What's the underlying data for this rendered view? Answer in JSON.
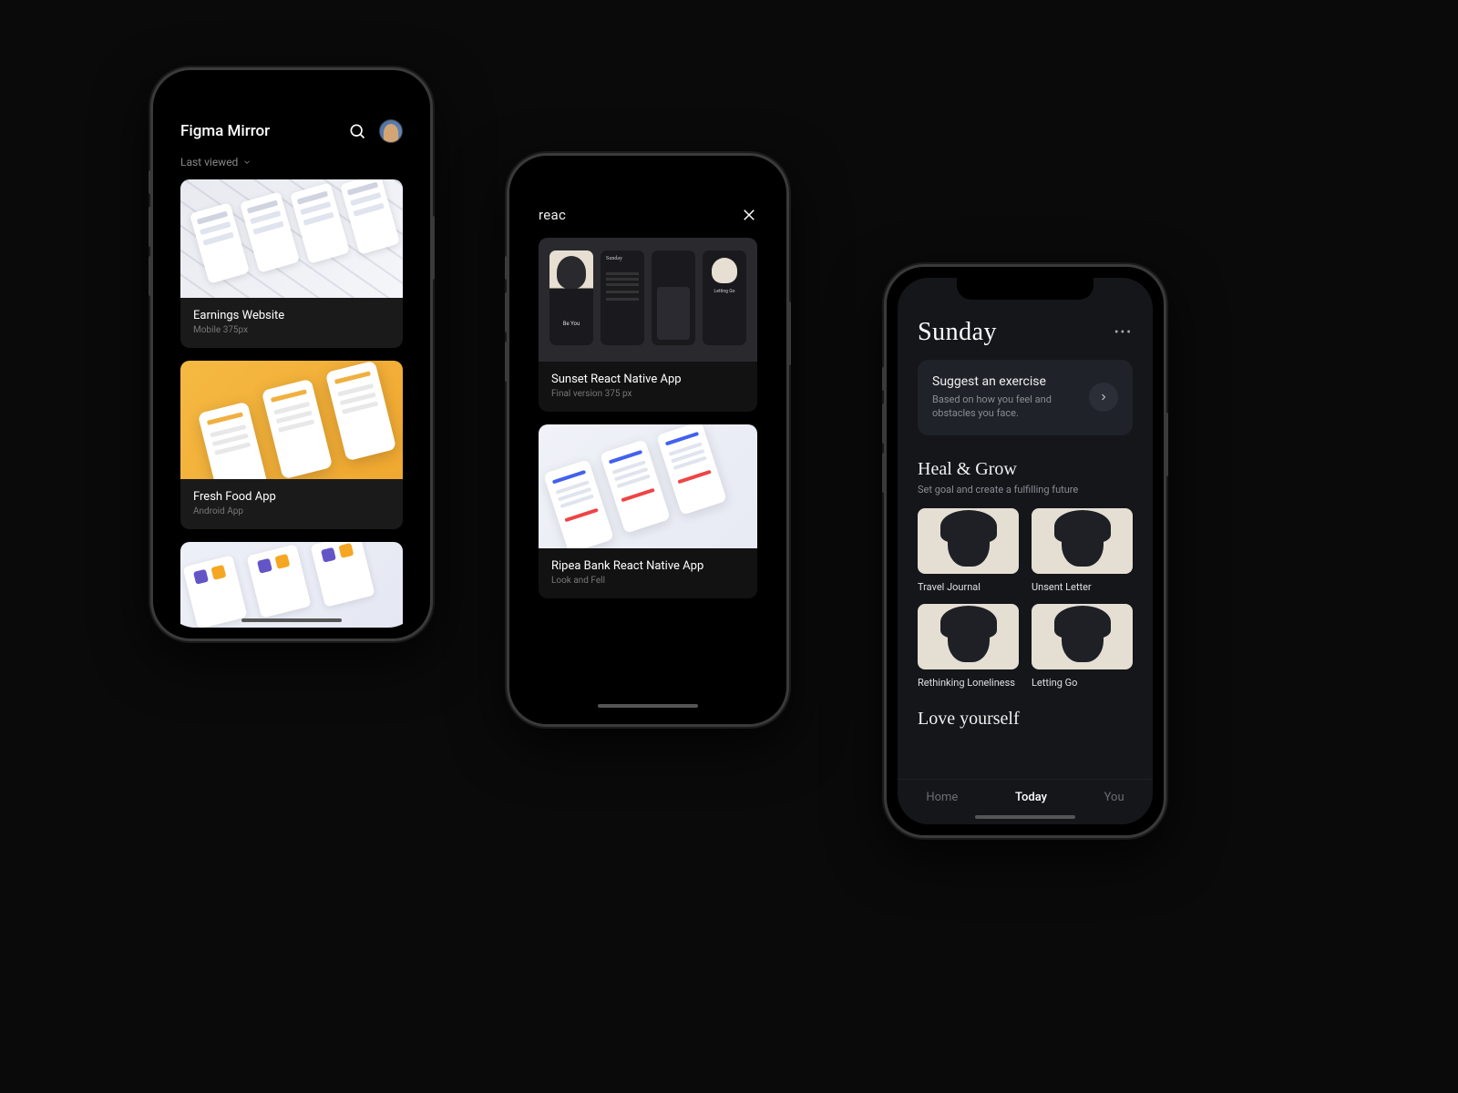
{
  "phone1": {
    "app_title": "Figma Mirror",
    "sort_label": "Last viewed",
    "cards": [
      {
        "title": "Earnings Website",
        "subtitle": "Mobile 375px"
      },
      {
        "title": "Fresh Food App",
        "subtitle": "Android App"
      }
    ]
  },
  "phone2": {
    "search_query": "reac",
    "cards": [
      {
        "title": "Sunset React Native App",
        "subtitle": "Final version 375 px"
      },
      {
        "title": "Ripea Bank React Native App",
        "subtitle": "Look and Fell"
      }
    ]
  },
  "phone3": {
    "title": "Sunday",
    "suggest": {
      "title": "Suggest an exercise",
      "subtitle": "Based on how you feel and obstacles you face."
    },
    "heal": {
      "title": "Heal & Grow",
      "subtitle": "Set goal and create a fulfilling future",
      "tiles": [
        {
          "label": "Travel Journal"
        },
        {
          "label": "Unsent Letter"
        },
        {
          "label": "Rethinking Loneliness"
        },
        {
          "label": "Letting Go"
        }
      ]
    },
    "love_title": "Love yourself",
    "tabs": {
      "home": "Home",
      "today": "Today",
      "you": "You"
    }
  }
}
